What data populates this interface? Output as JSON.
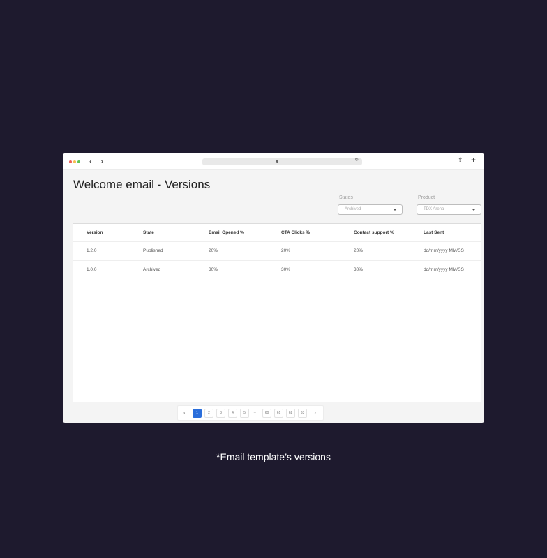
{
  "page": {
    "title": "Welcome email - Versions"
  },
  "filters": {
    "states": {
      "label": "States",
      "value": "Archived"
    },
    "product": {
      "label": "Product",
      "value": "TDX Arena"
    }
  },
  "table": {
    "headers": [
      "Version",
      "State",
      "Email Opened %",
      "CTA Clicks %",
      "Contact support %",
      "Last Sent"
    ],
    "rows": [
      [
        "1.2.0",
        "Published",
        "20%",
        "20%",
        "20%",
        "dd/mm/yyyy MM/SS"
      ],
      [
        "1.0.0",
        "Archived",
        "30%",
        "30%",
        "30%",
        "dd/mm/yyyy MM/SS"
      ]
    ]
  },
  "pagination": {
    "prev_icon": "‹",
    "next_icon": "›",
    "ellipsis": "...",
    "pages_start": [
      "1",
      "2",
      "3",
      "4",
      "5"
    ],
    "pages_end": [
      "60",
      "61",
      "62",
      "63"
    ],
    "active_page": "1"
  },
  "caption": "*Email template’s versions",
  "icons": {
    "back": "chevron-left-icon",
    "forward": "chevron-right-icon",
    "share": "share-icon",
    "new_tab": "plus-icon"
  },
  "colors": {
    "background": "#1e1a2e",
    "accent": "#2a6edb"
  }
}
